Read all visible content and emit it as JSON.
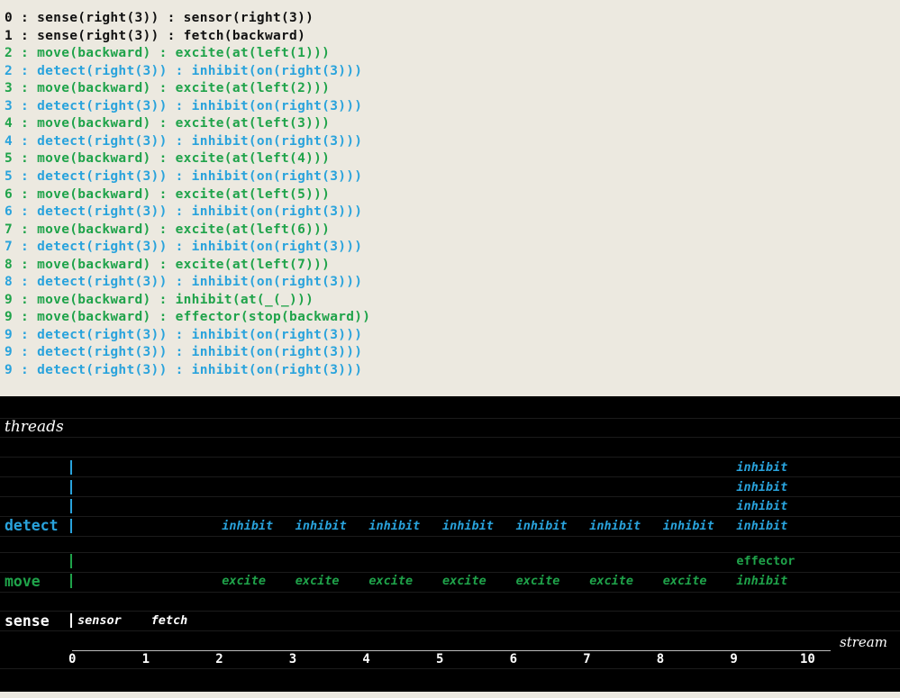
{
  "colors": {
    "black": "#111111",
    "green": "#1fa34a",
    "blue": "#29a3dc",
    "white": "#ffffff"
  },
  "log_lines": [
    {
      "text": "0 : sense(right(3)) : sensor(right(3))",
      "color": "black"
    },
    {
      "text": "1 : sense(right(3)) : fetch(backward)",
      "color": "black"
    },
    {
      "text": "2 : move(backward) : excite(at(left(1)))",
      "color": "green"
    },
    {
      "text": "2 : detect(right(3)) : inhibit(on(right(3)))",
      "color": "blue"
    },
    {
      "text": "3 : move(backward) : excite(at(left(2)))",
      "color": "green"
    },
    {
      "text": "3 : detect(right(3)) : inhibit(on(right(3)))",
      "color": "blue"
    },
    {
      "text": "4 : move(backward) : excite(at(left(3)))",
      "color": "green"
    },
    {
      "text": "4 : detect(right(3)) : inhibit(on(right(3)))",
      "color": "blue"
    },
    {
      "text": "5 : move(backward) : excite(at(left(4)))",
      "color": "green"
    },
    {
      "text": "5 : detect(right(3)) : inhibit(on(right(3)))",
      "color": "blue"
    },
    {
      "text": "6 : move(backward) : excite(at(left(5)))",
      "color": "green"
    },
    {
      "text": "6 : detect(right(3)) : inhibit(on(right(3)))",
      "color": "blue"
    },
    {
      "text": "7 : move(backward) : excite(at(left(6)))",
      "color": "green"
    },
    {
      "text": "7 : detect(right(3)) : inhibit(on(right(3)))",
      "color": "blue"
    },
    {
      "text": "8 : move(backward) : excite(at(left(7)))",
      "color": "green"
    },
    {
      "text": "8 : detect(right(3)) : inhibit(on(right(3)))",
      "color": "blue"
    },
    {
      "text": "9 : move(backward) : inhibit(at(_(_)))",
      "color": "green"
    },
    {
      "text": "9 : move(backward) : effector(stop(backward))",
      "color": "green"
    },
    {
      "text": "9 : detect(right(3)) : inhibit(on(right(3)))",
      "color": "blue"
    },
    {
      "text": "9 : detect(right(3)) : inhibit(on(right(3)))",
      "color": "blue"
    },
    {
      "text": "9 : detect(right(3)) : inhibit(on(right(3)))",
      "color": "blue"
    }
  ],
  "panel": {
    "title": "threads",
    "axis_label": "stream",
    "ticks": [
      "0",
      "1",
      "2",
      "3",
      "4",
      "5",
      "6",
      "7",
      "8",
      "9",
      "10"
    ],
    "threads": [
      {
        "name": "detect",
        "color": "blue"
      },
      {
        "name": "move",
        "color": "green"
      },
      {
        "name": "sense",
        "color": "white"
      }
    ],
    "events": [
      {
        "thread": "sense",
        "t": 0,
        "slot": 0,
        "label": "sensor"
      },
      {
        "thread": "sense",
        "t": 1,
        "slot": 0,
        "label": "fetch"
      },
      {
        "thread": "detect",
        "t": 2,
        "slot": 0,
        "label": "inhibit"
      },
      {
        "thread": "detect",
        "t": 3,
        "slot": 0,
        "label": "inhibit"
      },
      {
        "thread": "detect",
        "t": 4,
        "slot": 0,
        "label": "inhibit"
      },
      {
        "thread": "detect",
        "t": 5,
        "slot": 0,
        "label": "inhibit"
      },
      {
        "thread": "detect",
        "t": 6,
        "slot": 0,
        "label": "inhibit"
      },
      {
        "thread": "detect",
        "t": 7,
        "slot": 0,
        "label": "inhibit"
      },
      {
        "thread": "detect",
        "t": 8,
        "slot": 0,
        "label": "inhibit"
      },
      {
        "thread": "detect",
        "t": 9,
        "slot": 0,
        "label": "inhibit"
      },
      {
        "thread": "detect",
        "t": 9,
        "slot": 1,
        "label": "inhibit"
      },
      {
        "thread": "detect",
        "t": 9,
        "slot": 2,
        "label": "inhibit"
      },
      {
        "thread": "detect",
        "t": 9,
        "slot": 3,
        "label": "inhibit"
      },
      {
        "thread": "move",
        "t": 2,
        "slot": 0,
        "label": "excite"
      },
      {
        "thread": "move",
        "t": 3,
        "slot": 0,
        "label": "excite"
      },
      {
        "thread": "move",
        "t": 4,
        "slot": 0,
        "label": "excite"
      },
      {
        "thread": "move",
        "t": 5,
        "slot": 0,
        "label": "excite"
      },
      {
        "thread": "move",
        "t": 6,
        "slot": 0,
        "label": "excite"
      },
      {
        "thread": "move",
        "t": 7,
        "slot": 0,
        "label": "excite"
      },
      {
        "thread": "move",
        "t": 8,
        "slot": 0,
        "label": "excite"
      },
      {
        "thread": "move",
        "t": 9,
        "slot": 0,
        "label": "inhibit"
      },
      {
        "thread": "move",
        "t": 9,
        "slot": 1,
        "label": "effector"
      }
    ]
  }
}
